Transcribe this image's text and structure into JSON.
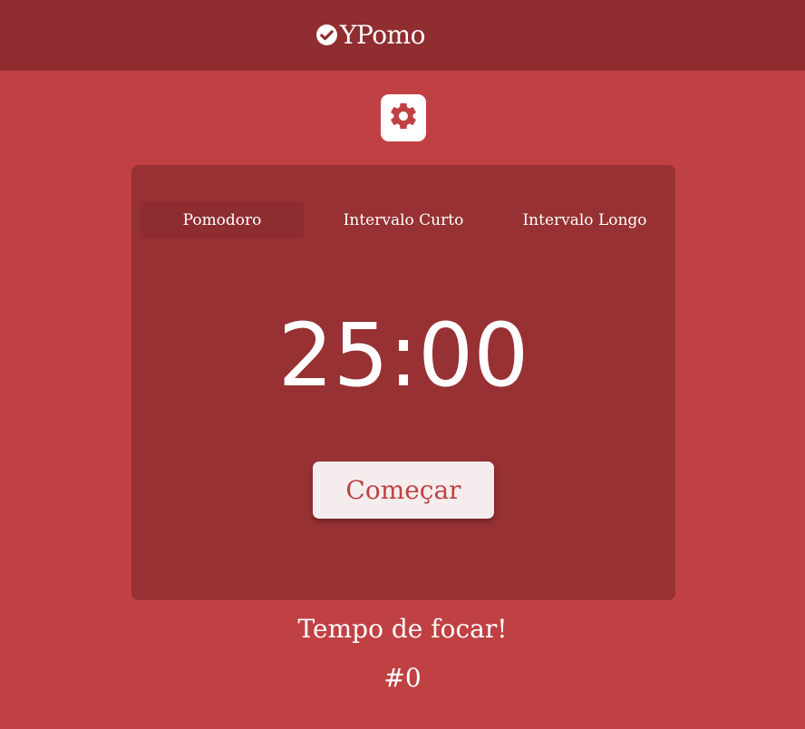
{
  "header": {
    "brand": "YPomo",
    "brand_icon": "check-circle-icon"
  },
  "settings": {
    "icon": "gear-icon"
  },
  "tabs": [
    {
      "label": "Pomodoro",
      "active": true
    },
    {
      "label": "Intervalo Curto",
      "active": false
    },
    {
      "label": "Intervalo Longo",
      "active": false
    }
  ],
  "timer": {
    "display": "25:00"
  },
  "start_button": {
    "label": "Começar"
  },
  "status": {
    "message": "Tempo de focar!",
    "session_count": "#0"
  },
  "colors": {
    "background": "#c04143",
    "header": "#8f2d30",
    "card": "#973133",
    "active_tab": "#8e2d30",
    "button_text": "#c04143"
  }
}
